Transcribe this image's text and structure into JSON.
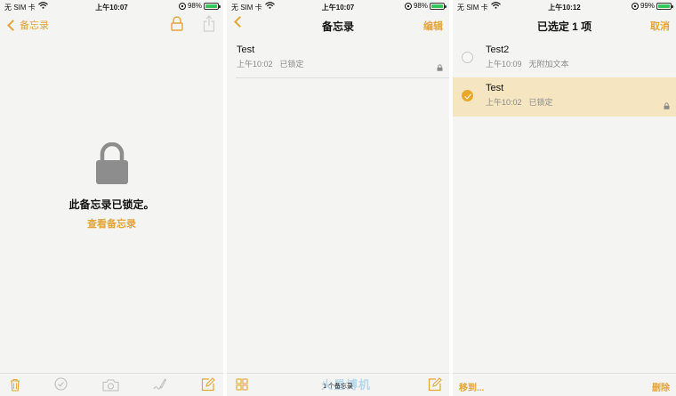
{
  "accent_color": "#e2a53a",
  "screen1": {
    "status": {
      "carrier": "无 SIM 卡",
      "time": "上午10:07",
      "battery": "98%",
      "battery_level": 0.98
    },
    "nav": {
      "back_label": "备忘录"
    },
    "locked_message": "此备忘录已锁定。",
    "view_note_link": "查看备忘录",
    "toolbar_icons": [
      "trash-icon",
      "checklist-icon",
      "camera-icon",
      "sketch-icon",
      "compose-icon"
    ]
  },
  "screen2": {
    "status": {
      "carrier": "无 SIM 卡",
      "time": "上午10:07",
      "battery": "98%",
      "battery_level": 0.98
    },
    "nav": {
      "title": "备忘录",
      "edit_label": "编辑"
    },
    "notes": [
      {
        "title": "Test",
        "time": "上午10:02",
        "preview": "已锁定",
        "locked": true
      }
    ],
    "toolbar": {
      "count_label": "1 个备忘录",
      "watermark": "火星博机"
    }
  },
  "screen3": {
    "status": {
      "carrier": "无 SIM 卡",
      "time": "上午10:12",
      "battery": "99%",
      "battery_level": 0.99
    },
    "nav": {
      "title": "已选定 1 项",
      "cancel_label": "取消"
    },
    "notes": [
      {
        "title": "Test2",
        "time": "上午10:09",
        "preview": "无附加文本",
        "locked": false,
        "selected": false
      },
      {
        "title": "Test",
        "time": "上午10:02",
        "preview": "已锁定",
        "locked": true,
        "selected": true
      }
    ],
    "toolbar": {
      "move_label": "移到...",
      "delete_label": "删除"
    }
  }
}
